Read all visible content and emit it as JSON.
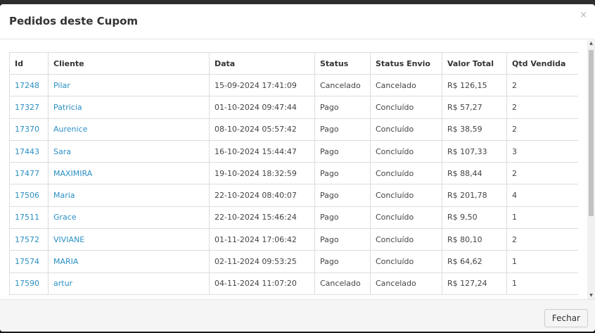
{
  "modal": {
    "title": "Pedidos deste Cupom",
    "close_glyph": "×",
    "footer_button": "Fechar"
  },
  "table": {
    "headers": [
      "Id",
      "Cliente",
      "Data",
      "Status",
      "Status Envio",
      "Valor Total",
      "Qtd Vendida"
    ],
    "rows": [
      [
        "17248",
        "Pilar",
        "15-09-2024 17:41:09",
        "Cancelado",
        "Cancelado",
        "R$ 126,15",
        "2"
      ],
      [
        "17327",
        "Patricia",
        "01-10-2024 09:47:44",
        "Pago",
        "Concluído",
        "R$ 57,27",
        "2"
      ],
      [
        "17370",
        "Aurenice",
        "08-10-2024 05:57:42",
        "Pago",
        "Concluído",
        "R$ 38,59",
        "2"
      ],
      [
        "17443",
        "Sara",
        "16-10-2024 15:44:47",
        "Pago",
        "Concluído",
        "R$ 107,33",
        "3"
      ],
      [
        "17477",
        "MAXIMIRA",
        "19-10-2024 18:32:59",
        "Pago",
        "Concluído",
        "R$ 88,44",
        "2"
      ],
      [
        "17506",
        "Maria",
        "22-10-2024 08:40:07",
        "Pago",
        "Concluído",
        "R$ 201,78",
        "4"
      ],
      [
        "17511",
        "Grace",
        "22-10-2024 15:46:24",
        "Pago",
        "Concluído",
        "R$ 9,50",
        "1"
      ],
      [
        "17572",
        "VIVIANE",
        "01-11-2024 17:06:42",
        "Pago",
        "Concluído",
        "R$ 80,10",
        "2"
      ],
      [
        "17574",
        "MARIA",
        "02-11-2024 09:53:25",
        "Pago",
        "Concluído",
        "R$ 64,62",
        "1"
      ],
      [
        "17590",
        "artur",
        "04-11-2024 11:07:20",
        "Cancelado",
        "Cancelado",
        "R$ 127,24",
        "1"
      ],
      [
        "",
        "",
        "",
        "",
        "",
        "",
        ""
      ]
    ]
  },
  "colors": {
    "link": "#2a8fc4",
    "border": "#dddddd",
    "footer_bg": "#f5f5f5"
  }
}
